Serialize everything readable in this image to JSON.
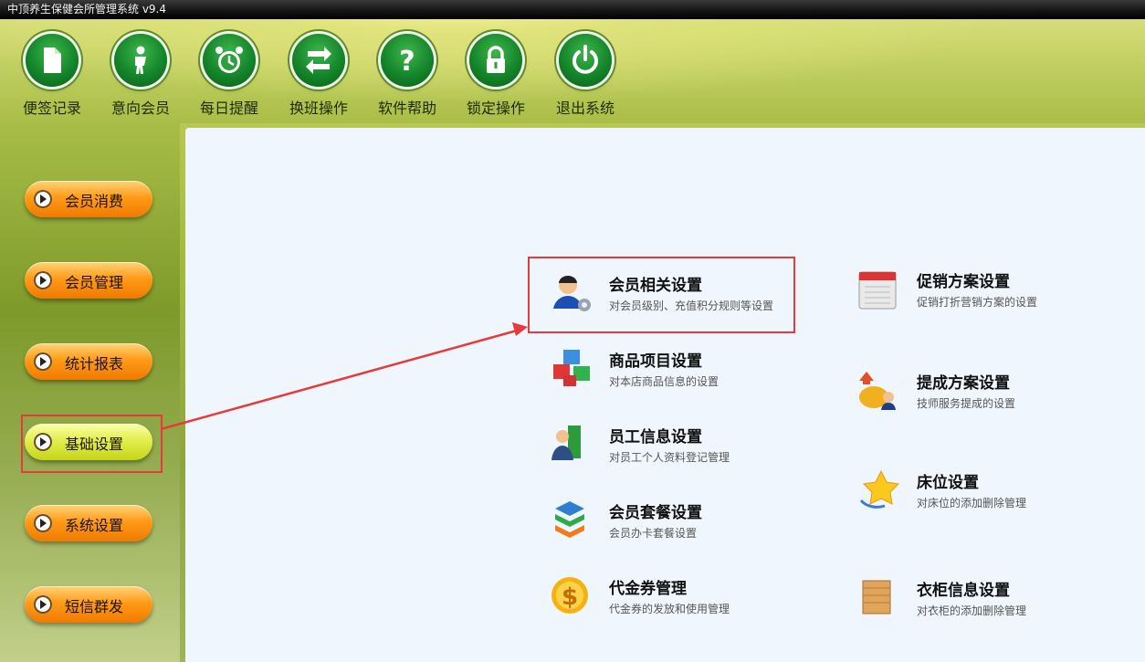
{
  "window": {
    "title": "中顶养生保健会所管理系统 v9.4"
  },
  "toolbar": [
    {
      "label": "便签记录",
      "icon": "note-icon"
    },
    {
      "label": "意向会员",
      "icon": "person-icon"
    },
    {
      "label": "每日提醒",
      "icon": "alarm-clock-icon"
    },
    {
      "label": "换班操作",
      "icon": "swap-arrows-icon"
    },
    {
      "label": "软件帮助",
      "icon": "help-icon"
    },
    {
      "label": "锁定操作",
      "icon": "lock-icon"
    },
    {
      "label": "退出系统",
      "icon": "power-icon"
    }
  ],
  "sidebar": {
    "items": [
      {
        "label": "会员消费",
        "active": false
      },
      {
        "label": "会员管理",
        "active": false
      },
      {
        "label": "统计报表",
        "active": false
      },
      {
        "label": "基础设置",
        "active": true
      },
      {
        "label": "系统设置",
        "active": false
      },
      {
        "label": "短信群发",
        "active": false
      }
    ]
  },
  "settings": {
    "left": [
      {
        "name": "会员相关设置",
        "desc": "对会员级别、充值积分规则等设置",
        "icon": "member-settings-icon"
      },
      {
        "name": "商品项目设置",
        "desc": "对本店商品信息的设置",
        "icon": "cubes-icon"
      },
      {
        "name": "员工信息设置",
        "desc": "对员工个人资料登记管理",
        "icon": "staff-icon"
      },
      {
        "name": "会员套餐设置",
        "desc": "会员办卡套餐设置",
        "icon": "layers-icon"
      },
      {
        "name": "代金券管理",
        "desc": "代金券的发放和使用管理",
        "icon": "dollar-coin-icon"
      }
    ],
    "right": [
      {
        "name": "促销方案设置",
        "desc": "促销打折营销方案的设置",
        "icon": "calendar-icon"
      },
      {
        "name": "提成方案设置",
        "desc": "技师服务提成的设置",
        "icon": "commission-icon"
      },
      {
        "name": "床位设置",
        "desc": "对床位的添加删除管理",
        "icon": "star-icon"
      },
      {
        "name": "衣柜信息设置",
        "desc": "对衣柜的添加删除管理",
        "icon": "cabinet-icon"
      }
    ]
  },
  "colors": {
    "highlight": "#e83a3a",
    "panel_bg": "#eff6fd",
    "toolbar_disc": "#14852a",
    "button_orange": "#ff9b18",
    "button_active": "#e3ee4f"
  }
}
